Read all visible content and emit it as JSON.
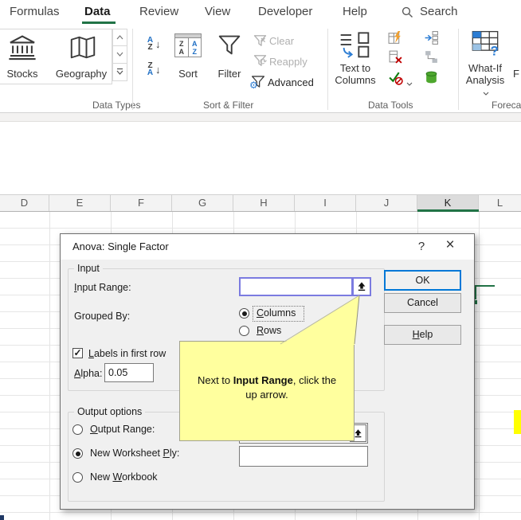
{
  "ribbon": {
    "tabs": [
      {
        "label": "Formulas",
        "active": false
      },
      {
        "label": "Data",
        "active": true
      },
      {
        "label": "Review",
        "active": false
      },
      {
        "label": "View",
        "active": false
      },
      {
        "label": "Developer",
        "active": false
      },
      {
        "label": "Help",
        "active": false
      }
    ],
    "search_label": "Search",
    "data_types": {
      "group_label": "Data Types",
      "stocks_label": "Stocks",
      "geography_label": "Geography"
    },
    "sort_filter": {
      "group_label": "Sort & Filter",
      "sort_label": "Sort",
      "filter_label": "Filter",
      "clear_label": "Clear",
      "reapply_label": "Reapply",
      "advanced_label": "Advanced",
      "az_top": "A",
      "az_bottom": "Z",
      "za_top": "Z",
      "za_bottom": "A",
      "sort_icon_letters": {
        "l1": "Z",
        "l2": "A",
        "r1": "A",
        "r2": "Z"
      }
    },
    "data_tools": {
      "group_label": "Data Tools",
      "text_to_columns_line1": "Text to",
      "text_to_columns_line2": "Columns"
    },
    "forecast": {
      "group_label": "Foreca",
      "whatif_line1": "What-If",
      "whatif_line2": "Analysis",
      "partial_button_label": "F"
    }
  },
  "sheet": {
    "columns": [
      "D",
      "E",
      "F",
      "G",
      "H",
      "I",
      "J",
      "K",
      "L"
    ],
    "selected_column": "K",
    "yellow_cell_color": "#ffff00",
    "selection_color": "#217346"
  },
  "dialog": {
    "title": "Anova: Single Factor",
    "help_glyph": "?",
    "close_glyph": "×",
    "input_group_label": "Input",
    "input_range_label": {
      "text": "Input Range:",
      "accel": 0
    },
    "input_range_value": "",
    "grouped_by_label": "Grouped By:",
    "columns_label": {
      "text": "Columns",
      "accel": 0
    },
    "rows_label": {
      "text": "Rows",
      "accel": 0
    },
    "labels_checkbox_label": {
      "text": "Labels in first row",
      "accel": 0
    },
    "alpha_label": {
      "text": "Alpha:",
      "accel": 0
    },
    "alpha_value": "0.05",
    "output_group_label": "Output options",
    "output_range_label": {
      "text": "Output Range:",
      "accel": 0
    },
    "new_worksheet_label": {
      "text": "New Worksheet Ply:",
      "accel": 14
    },
    "new_worksheet_value": "",
    "new_workbook_label": {
      "text": "New Workbook",
      "accel": 4
    },
    "ok_label": "OK",
    "cancel_label": "Cancel",
    "help_label": {
      "text": "Help",
      "accel": 0
    }
  },
  "callout": {
    "line1_prefix": "Next to ",
    "line1_bold": "Input Range",
    "line1_suffix": ", click the",
    "line2": "up arrow.",
    "bg_color": "#ffff9e"
  },
  "colors": {
    "excel_green": "#217346",
    "focus_blue": "#7b7be0",
    "ok_border": "#0078d7"
  }
}
